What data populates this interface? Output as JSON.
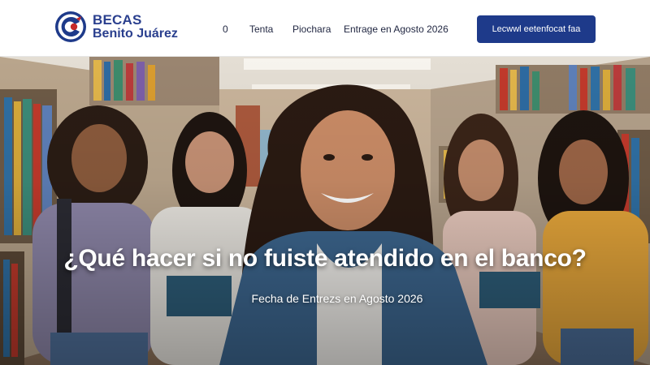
{
  "brand": {
    "line1": "BECAS",
    "line2": "Benito Juárez",
    "logo_icon": "becas-logo-icon",
    "colors": {
      "primary": "#1e3a8a",
      "accent": "#c62828"
    }
  },
  "nav": {
    "items": [
      {
        "label": "0"
      },
      {
        "label": "Tenta"
      },
      {
        "label": "Piochara"
      },
      {
        "label": "Entrage en  Agosto 2026"
      }
    ],
    "cta_label": "Lecwwl eetenfocat faa"
  },
  "hero": {
    "title": "¿Qué hacer si no fuiste atendido en el banco?",
    "subtitle": "Fecha de Entrezs en Agosto 2026",
    "photo": "students-in-library-photo"
  }
}
